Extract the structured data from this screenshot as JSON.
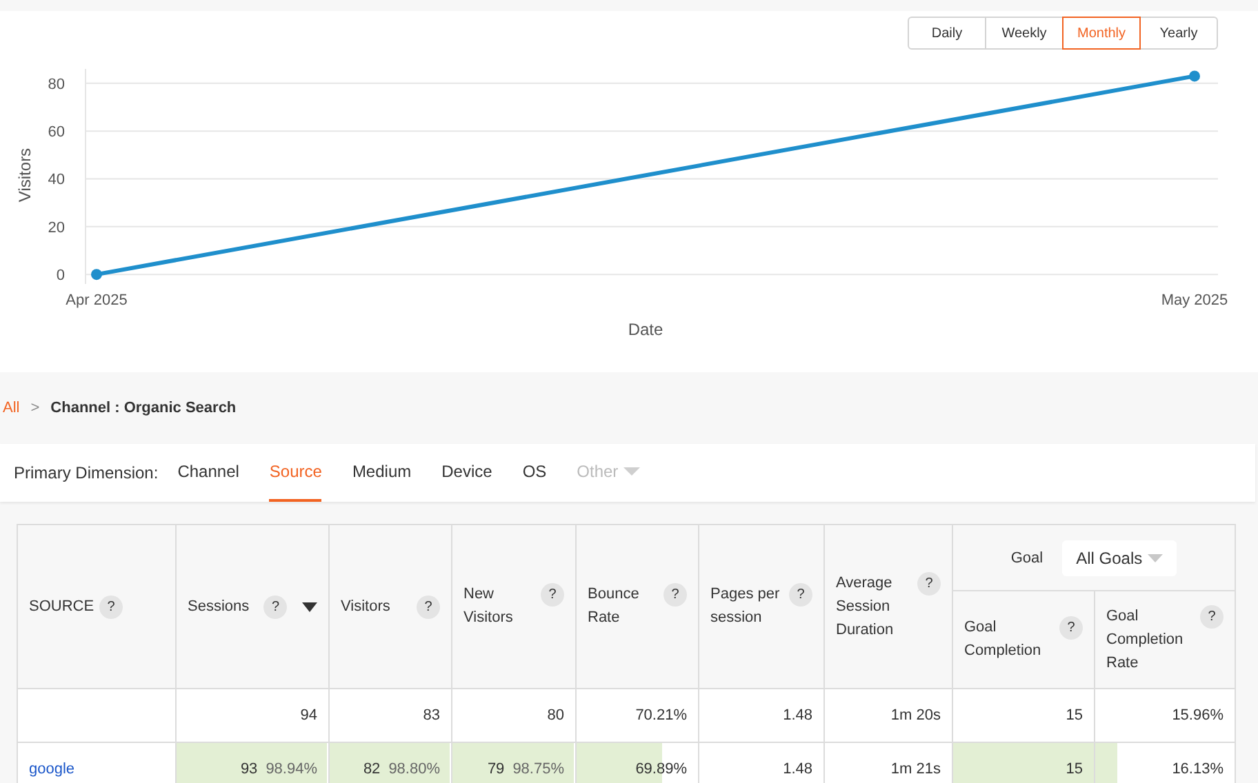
{
  "periods": [
    {
      "label": "Daily",
      "selected": false
    },
    {
      "label": "Weekly",
      "selected": false
    },
    {
      "label": "Monthly",
      "selected": true
    },
    {
      "label": "Yearly",
      "selected": false
    }
  ],
  "chart": {
    "chart_data": {
      "type": "line",
      "xlabel": "Date",
      "ylabel": "Visitors",
      "categories": [
        "Apr 2025",
        "May 2025"
      ],
      "series": [
        {
          "color": "#1f8fcc",
          "marker": true,
          "values": [
            0,
            83
          ]
        }
      ],
      "ylim": [
        -4,
        86
      ],
      "yticks": [
        0,
        20,
        40,
        60,
        80
      ]
    }
  },
  "breadcrumb": {
    "root": "All",
    "separator": ">",
    "current": "Channel : Organic Search"
  },
  "dimension_bar": {
    "label": "Primary Dimension:",
    "tabs": [
      {
        "label": "Channel",
        "selected": false,
        "disabled": false
      },
      {
        "label": "Source",
        "selected": true,
        "disabled": false
      },
      {
        "label": "Medium",
        "selected": false,
        "disabled": false
      },
      {
        "label": "Device",
        "selected": false,
        "disabled": false
      },
      {
        "label": "OS",
        "selected": false,
        "disabled": false
      },
      {
        "label": "Other",
        "selected": false,
        "disabled": true
      }
    ]
  },
  "table": {
    "goal_group": {
      "label": "Goal",
      "select": "All Goals"
    },
    "columns": [
      {
        "label": "SOURCE",
        "help": "?",
        "sorted": false
      },
      {
        "label": "Sessions",
        "help": "?",
        "sorted": true
      },
      {
        "label": "Visitors",
        "help": "?",
        "sorted": false
      },
      {
        "label": "New Visitors",
        "help": "?",
        "sorted": false
      },
      {
        "label": "Bounce Rate",
        "help": "?",
        "sorted": false
      },
      {
        "label": "Pages per session",
        "help": "?",
        "sorted": false
      },
      {
        "label": "Average Session Duration",
        "help": "?",
        "sorted": false
      },
      {
        "label": "Goal Completion",
        "help": "?"
      },
      {
        "label": "Goal Completion Rate",
        "help": "?"
      }
    ],
    "totals": [
      {
        "value": "94"
      },
      {
        "value": "83"
      },
      {
        "value": "80"
      },
      {
        "value": "70.21%"
      },
      {
        "value": "1.48"
      },
      {
        "value": "1m 20s"
      },
      {
        "value": "15"
      },
      {
        "value": "15.96%"
      }
    ],
    "rows": [
      {
        "cells": [
          {
            "value": "google",
            "kind": "link"
          },
          {
            "value": "93",
            "share": "98.94%",
            "level": 0.99
          },
          {
            "value": "82",
            "share": "98.80%",
            "level": 0.99
          },
          {
            "value": "79",
            "share": "98.75%",
            "level": 0.99
          },
          {
            "value": "69.89%",
            "level": 0.7
          },
          {
            "value": "1.48"
          },
          {
            "value": "1m 21s"
          },
          {
            "value": "15",
            "level": 1
          },
          {
            "value": "16.13%",
            "level": 0.16
          }
        ]
      }
    ]
  }
}
